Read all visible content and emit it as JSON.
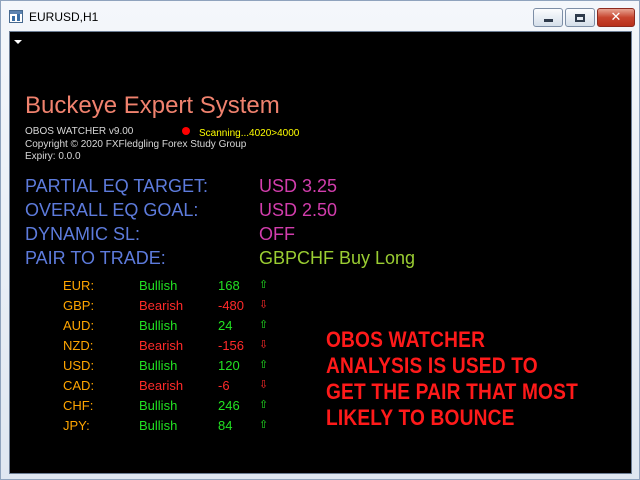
{
  "window": {
    "title": "EURUSD,H1"
  },
  "expert": {
    "title": "Buckeye Expert System",
    "module_name": "OBOS WATCHER v9.00",
    "scan_status": "Scanning...4020>4000",
    "copyright": "Copyright © 2020 FXFledgling Forex Study Group",
    "expiry": "Expiry: 0.0.0",
    "status_colors": {
      "scan_dot": "#ff0000",
      "scan_text": "#ffff00",
      "title": "#f0826e"
    }
  },
  "info_rows": [
    {
      "label": "PARTIAL EQ TARGET:",
      "value": "USD 3.25",
      "value_color": "#d23dac"
    },
    {
      "label": "OVERALL EQ GOAL:",
      "value": "USD 2.50",
      "value_color": "#d23dac"
    },
    {
      "label": "DYNAMIC SL:",
      "value": "OFF",
      "value_color": "#d23dac"
    },
    {
      "label": "PAIR TO TRADE:",
      "value": "GBPCHF Buy Long",
      "value_color": "#9acd32"
    }
  ],
  "currencies": [
    {
      "name": "EUR:",
      "trend": "Bullish",
      "value": "168",
      "direction": "up"
    },
    {
      "name": "GBP:",
      "trend": "Bearish",
      "value": "-480",
      "direction": "down"
    },
    {
      "name": "AUD:",
      "trend": "Bullish",
      "value": "24",
      "direction": "up"
    },
    {
      "name": "NZD:",
      "trend": "Bearish",
      "value": "-156",
      "direction": "down"
    },
    {
      "name": "USD:",
      "trend": "Bullish",
      "value": "120",
      "direction": "up"
    },
    {
      "name": "CAD:",
      "trend": "Bearish",
      "value": "-6",
      "direction": "down"
    },
    {
      "name": "CHF:",
      "trend": "Bullish",
      "value": "246",
      "direction": "up"
    },
    {
      "name": "JPY:",
      "trend": "Bullish",
      "value": "84",
      "direction": "up"
    }
  ],
  "colors": {
    "bullish": "#22e022",
    "bearish": "#ff2a2a"
  },
  "callout": {
    "lines": [
      "OBOS WATCHER",
      "ANALYSIS IS USED TO",
      "GET THE PAIR THAT MOST",
      "LIKELY TO BOUNCE"
    ]
  }
}
